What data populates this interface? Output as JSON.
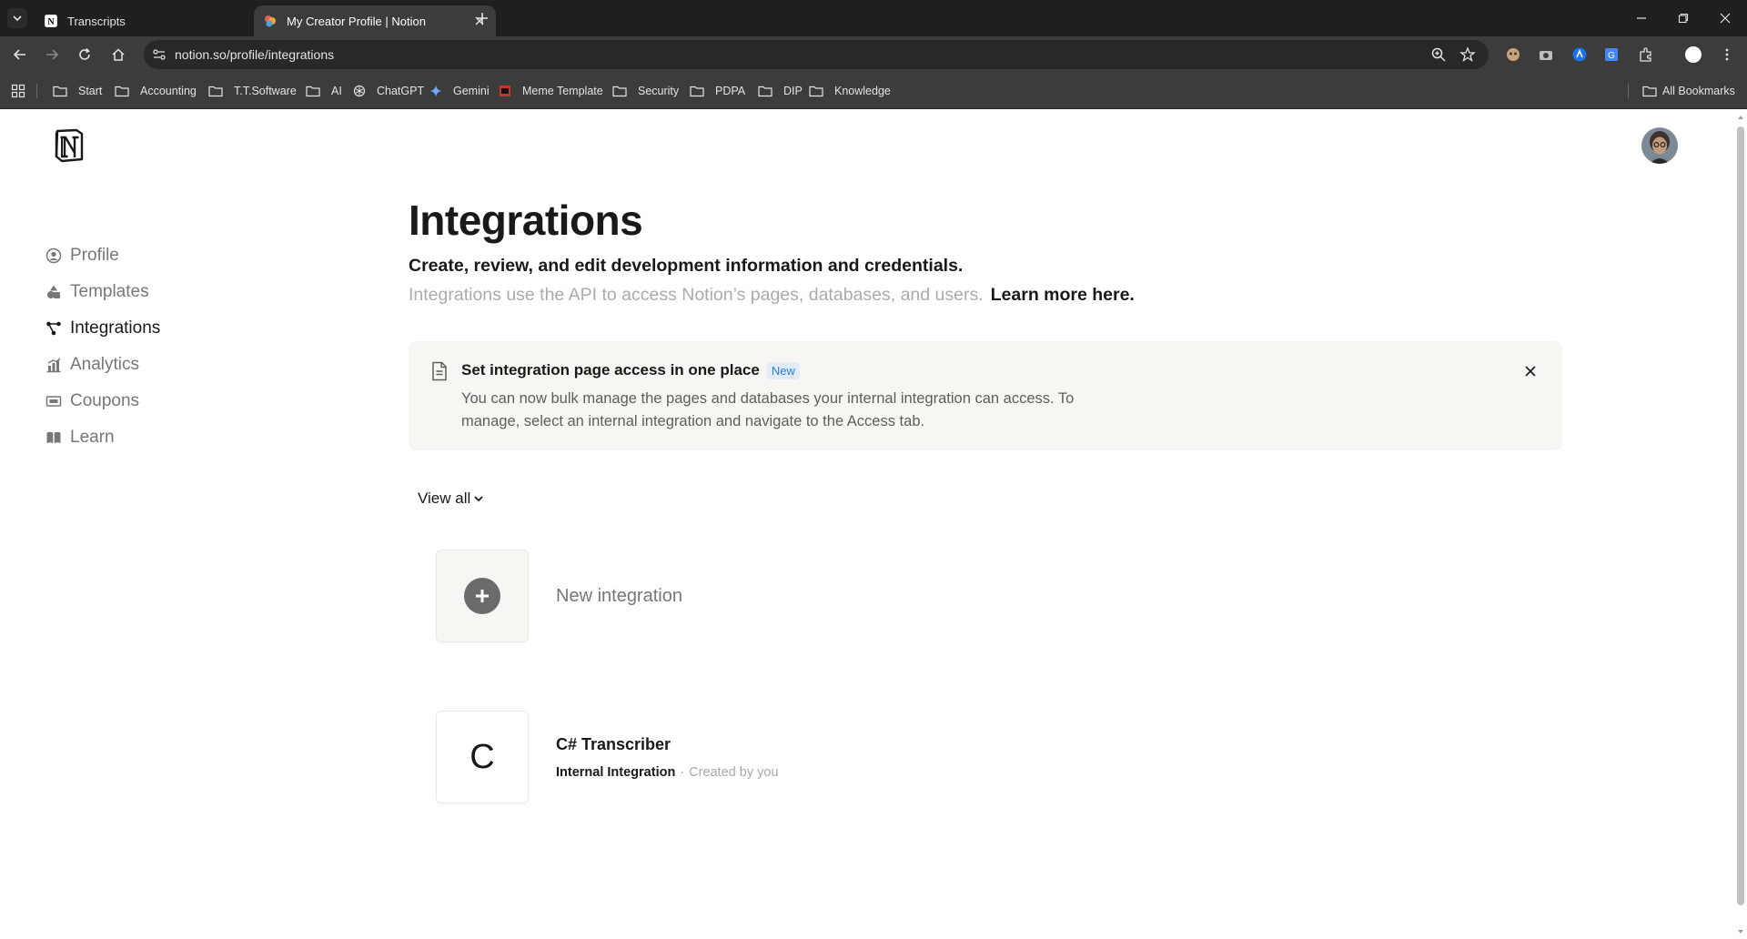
{
  "browser": {
    "tabs": [
      {
        "title": "Transcripts",
        "active": false
      },
      {
        "title": "My Creator Profile | Notion",
        "active": true
      }
    ],
    "url": "notion.so/profile/integrations",
    "bookmarks": [
      {
        "label": "Start",
        "icon": "folder-icon"
      },
      {
        "label": "Accounting",
        "icon": "folder-icon"
      },
      {
        "label": "T.T.Software",
        "icon": "folder-icon"
      },
      {
        "label": "AI",
        "icon": "folder-icon"
      },
      {
        "label": "ChatGPT",
        "icon": "chatgpt-icon"
      },
      {
        "label": "Gemini",
        "icon": "gemini-icon"
      },
      {
        "label": "Meme Template",
        "icon": "meme-icon"
      },
      {
        "label": "Security",
        "icon": "folder-icon"
      },
      {
        "label": "PDPA",
        "icon": "folder-icon"
      },
      {
        "label": "DIP",
        "icon": "folder-icon"
      },
      {
        "label": "Knowledge",
        "icon": "folder-icon"
      }
    ],
    "all_bookmarks": "All Bookmarks"
  },
  "sidebar": {
    "items": [
      {
        "label": "Profile",
        "icon": "profile-icon"
      },
      {
        "label": "Templates",
        "icon": "templates-icon"
      },
      {
        "label": "Integrations",
        "icon": "integrations-icon",
        "active": true
      },
      {
        "label": "Analytics",
        "icon": "analytics-icon"
      },
      {
        "label": "Coupons",
        "icon": "coupons-icon"
      },
      {
        "label": "Learn",
        "icon": "learn-icon"
      }
    ]
  },
  "main": {
    "title": "Integrations",
    "subtitle": "Create, review, and edit development information and credentials.",
    "description": "Integrations use the API to access Notion’s pages, databases, and users.",
    "learn_more": "Learn more here.",
    "callout": {
      "title": "Set integration page access in one place",
      "badge": "New",
      "body": "You can now bulk manage the pages and databases your internal integration can access. To manage, select an internal integration and navigate to the Access tab."
    },
    "view_filter": "View all",
    "new_integration": "New integration",
    "integrations": [
      {
        "letter": "C",
        "name": "C# Transcriber",
        "type": "Internal Integration",
        "separator": "·",
        "creator": "Created by you"
      }
    ]
  },
  "colors": {
    "chrome_dark": "#1f1f1f",
    "chrome_toolbar": "#3c3c3c",
    "text_primary": "#191919",
    "text_secondary": "#787774",
    "callout_bg": "#f7f6f3",
    "badge_blue": "#2383e2"
  }
}
